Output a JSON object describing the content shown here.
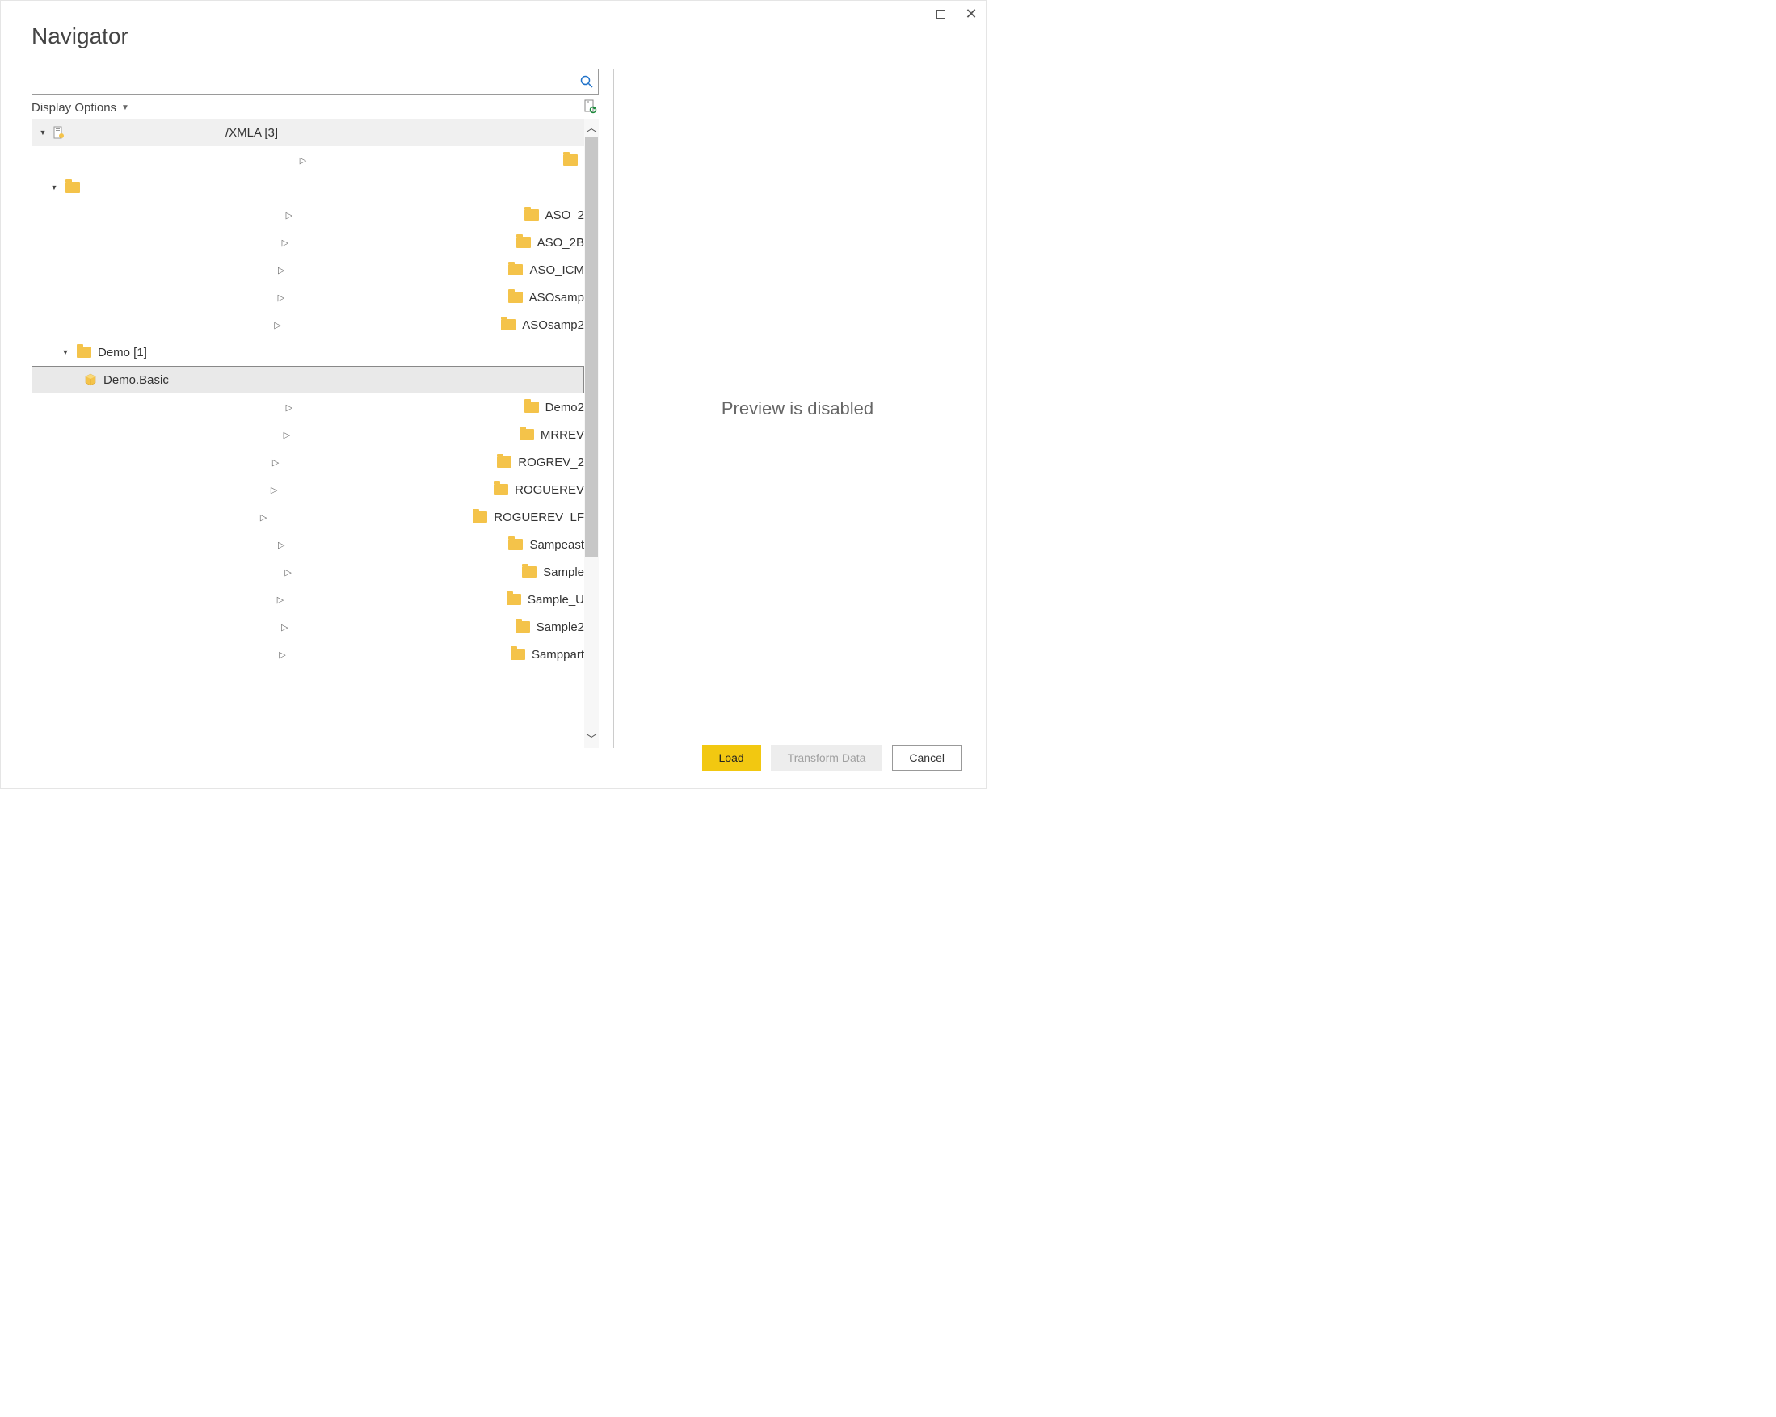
{
  "window": {
    "title": "Navigator"
  },
  "search": {
    "value": "",
    "placeholder": ""
  },
  "display_options_label": "Display Options",
  "tree": {
    "root": {
      "label": "/XMLA [3]"
    },
    "items": [
      {
        "label": "ASO_2"
      },
      {
        "label": "ASO_2B"
      },
      {
        "label": "ASO_ICM"
      },
      {
        "label": "ASOsamp"
      },
      {
        "label": "ASOsamp2"
      },
      {
        "label": "Demo [1]",
        "expanded": true
      },
      {
        "label": "Demo.Basic",
        "leaf": true,
        "selected": true
      },
      {
        "label": "Demo2"
      },
      {
        "label": "MRREV"
      },
      {
        "label": "ROGREV_2"
      },
      {
        "label": "ROGUEREV"
      },
      {
        "label": "ROGUEREV_LF"
      },
      {
        "label": "Sampeast"
      },
      {
        "label": "Sample"
      },
      {
        "label": "Sample_U"
      },
      {
        "label": "Sample2"
      },
      {
        "label": "Samppart"
      }
    ]
  },
  "preview": {
    "message": "Preview is disabled"
  },
  "buttons": {
    "load": "Load",
    "transform": "Transform Data",
    "cancel": "Cancel"
  }
}
